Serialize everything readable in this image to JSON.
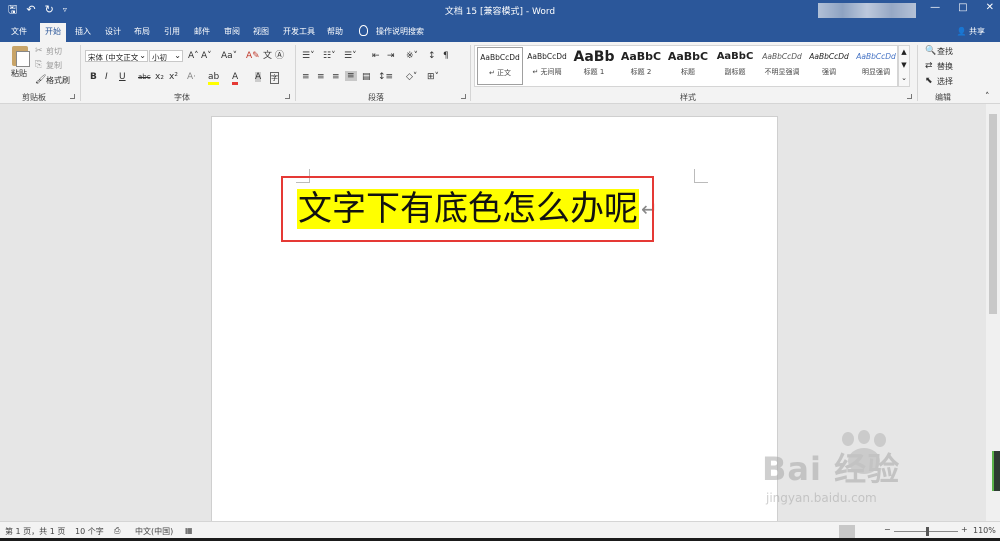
{
  "title_bar": {
    "doc_title": "文档 15 [兼容模式]  -  Word",
    "qat": [
      "save-icon",
      "undo-icon",
      "redo-icon",
      "customize-icon"
    ],
    "window_buttons": [
      "—",
      "□",
      "✕"
    ]
  },
  "tabs": [
    "文件",
    "开始",
    "插入",
    "设计",
    "布局",
    "引用",
    "邮件",
    "审阅",
    "视图",
    "开发工具",
    "帮助"
  ],
  "active_tab": "开始",
  "tell_me": "操作说明搜索",
  "share": "共享",
  "clipboard": {
    "paste": "粘贴",
    "cut": "剪切",
    "copy": "复制",
    "format_painter": "格式刷",
    "label": "剪贴板"
  },
  "font": {
    "name": "宋体 (中文正文",
    "size": "小初",
    "label": "字体",
    "buttons": [
      "B",
      "I",
      "U",
      "abc",
      "x₂",
      "x²"
    ],
    "row1_icons": [
      "A^",
      "A˅",
      "Aa",
      "✎",
      "文"
    ]
  },
  "paragraph": {
    "label": "段落"
  },
  "styles": {
    "label": "样式",
    "items": [
      {
        "sample": "AaBbCcDd",
        "name": "↵ 正文"
      },
      {
        "sample": "AaBbCcDd",
        "name": "↵ 无间隔"
      },
      {
        "sample": "AaBb",
        "name": "标题 1"
      },
      {
        "sample": "AaBbC",
        "name": "标题 2"
      },
      {
        "sample": "AaBbC",
        "name": "标题"
      },
      {
        "sample": "AaBbC",
        "name": "副标题"
      },
      {
        "sample": "AaBbCcDd",
        "name": "不明显强调"
      },
      {
        "sample": "AaBbCcDd",
        "name": "强调"
      },
      {
        "sample": "AaBbCcDd",
        "name": "明显强调"
      }
    ]
  },
  "editing": {
    "label": "编辑",
    "find": "查找",
    "replace": "替换",
    "select": "选择"
  },
  "document": {
    "text": "文字下有底色怎么办呢",
    "highlight_color": "#ffff00",
    "box_color": "#e53935"
  },
  "status": {
    "page": "第 1 页，共 1 页",
    "words": "10 个字",
    "language": "中文(中国)",
    "zoom": "110%"
  },
  "watermark": {
    "title": "Bai  经验",
    "url": "jingyan.baidu.com"
  },
  "colors": {
    "accent": "#2b579a",
    "ribbon": "#f3f3f3"
  }
}
